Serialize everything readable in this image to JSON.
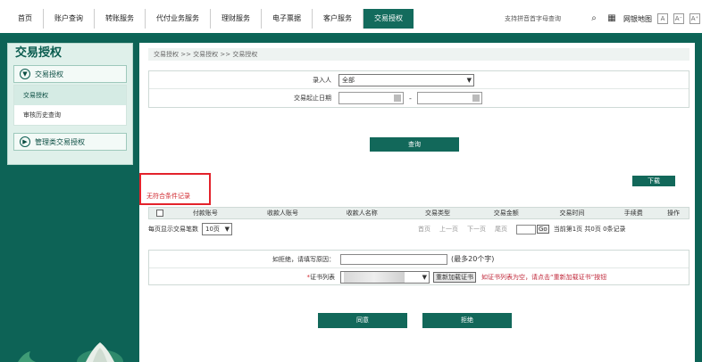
{
  "topnav": {
    "items": [
      "首页",
      "账户查询",
      "转账服务",
      "代付业务服务",
      "理财服务",
      "电子票据",
      "客户服务",
      "交易授权"
    ],
    "active_index": 7,
    "search_placeholder": "支持拼音首字母查询",
    "sitemap": "网银地图",
    "font_labels": [
      "A",
      "A⁻",
      "A⁺"
    ]
  },
  "sidebar": {
    "title": "交易授权",
    "group1": "交易授权",
    "subitems": [
      "交易授权",
      "审核历史查询"
    ],
    "group2": "管理类交易授权"
  },
  "breadcrumb": "交易授权 >> 交易授权 >> 交易授权",
  "query_form": {
    "entry_label": "录入人",
    "entry_value": "全部",
    "date_label": "交易起止日期",
    "date_sep": "-",
    "query_button": "查询"
  },
  "download_button": "下载",
  "no_record_msg": "无符合条件记录",
  "table": {
    "columns": [
      "付款账号",
      "收款人账号",
      "收款人名称",
      "交易类型",
      "交易金额",
      "交易时间",
      "手续费",
      "操作"
    ]
  },
  "pager": {
    "per_page_label": "每页显示交易笔数",
    "per_page_value": "10页",
    "first": "首页",
    "prev": "上一页",
    "next": "下一页",
    "last": "尾页",
    "go": "Go",
    "status": "当前第1页 共0页 0条记录"
  },
  "approve_form": {
    "reject_label": "如拒绝，请填写原因：",
    "reject_hint": "(最多20个字)",
    "cert_label": "证书列表",
    "reload_button": "重新加载证书",
    "cert_tip": "如证书列表为空，请点击“重新加载证书”按钮"
  },
  "actions": {
    "approve": "同意",
    "reject": "拒绝"
  },
  "colors": {
    "brand": "#12685a",
    "alert": "#e3222b",
    "tip": "#c0283a"
  }
}
